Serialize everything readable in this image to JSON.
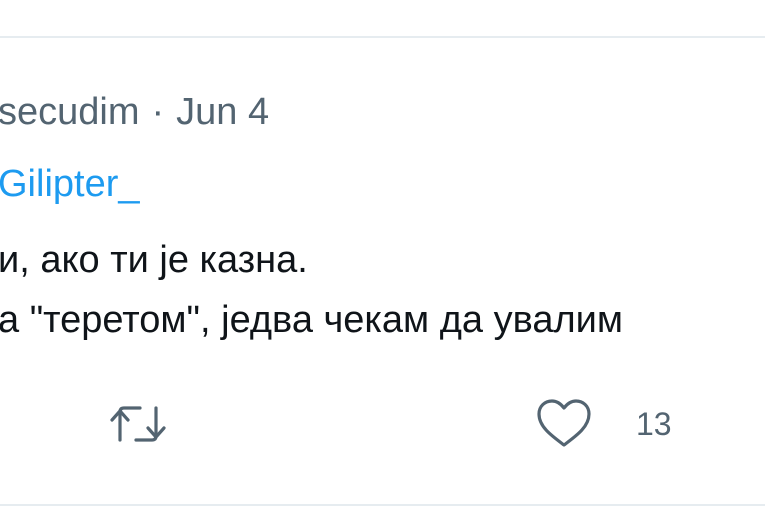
{
  "tweet": {
    "handle": "secudim",
    "separator": "·",
    "date": "Jun 4",
    "replying_to": "Gilipter_",
    "text_lines": [
      "и, ако ти је казна.",
      "а \"теретом\", једва чекам да увалим"
    ]
  },
  "actions": {
    "retweet_icon": "retweet-icon",
    "like_icon": "heart-icon",
    "like_count": "13"
  },
  "colors": {
    "secondary_text": "#536471",
    "link": "#1d9bf0",
    "primary_text": "#0f1419",
    "divider": "#e6ecf0"
  }
}
